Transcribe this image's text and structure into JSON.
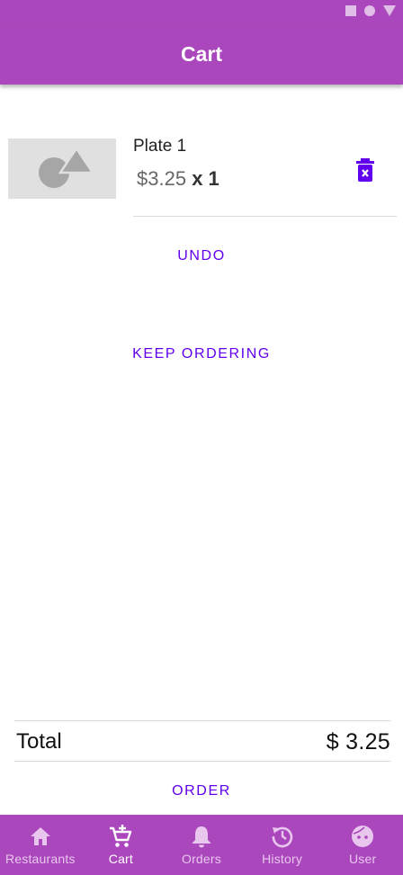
{
  "colors": {
    "primary": "#ab47bc",
    "accent": "#6200ee",
    "nav_inactive": "#e8c6ee",
    "nav_active": "#ffffff"
  },
  "app_bar": {
    "title": "Cart"
  },
  "cart_item": {
    "name": "Plate 1",
    "price": "$3.25",
    "multiplier": "x 1",
    "thumbnail_icon": "image-placeholder-icon",
    "delete_icon": "trash-icon"
  },
  "actions": {
    "undo_label": "UNDO",
    "keep_ordering_label": "KEEP ORDERING",
    "order_label": "ORDER"
  },
  "total": {
    "label": "Total",
    "value": "$ 3.25"
  },
  "bottom_nav": {
    "items": [
      {
        "label": "Restaurants",
        "icon": "home-icon"
      },
      {
        "label": "Cart",
        "icon": "cart-icon"
      },
      {
        "label": "Orders",
        "icon": "bell-icon"
      },
      {
        "label": "History",
        "icon": "history-icon"
      },
      {
        "label": "User",
        "icon": "face-icon"
      }
    ]
  }
}
